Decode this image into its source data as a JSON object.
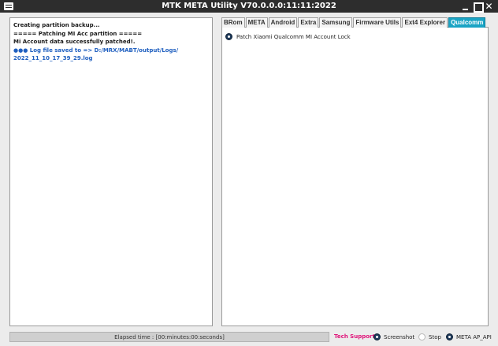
{
  "window": {
    "title": "MTK META Utility V70.0.0.0:11:11:2022",
    "minimize_glyph": "",
    "maximize_glyph": "",
    "close_glyph": "✕"
  },
  "log": {
    "lines": [
      {
        "text": "Creating partition backup..."
      },
      {
        "text": "===== Patching MI Acc partition ====="
      },
      {
        "text": "Mi Account data successfully patched!."
      },
      {
        "text": "●●● Log file saved to => D:/MRX/MABT/output/Logs/"
      },
      {
        "text": "2022_11_10_17_39_29.log"
      }
    ]
  },
  "tabs": [
    {
      "label": "BRom"
    },
    {
      "label": "META"
    },
    {
      "label": "Android"
    },
    {
      "label": "Extra"
    },
    {
      "label": "Samsung"
    },
    {
      "label": "Firmware Utils"
    },
    {
      "label": "Ext4 Explorer"
    },
    {
      "label": "Qualcomm"
    }
  ],
  "active_tab": "Qualcomm",
  "qualcomm": {
    "option_label": "Patch Xiaomi Qualcomm MI Account Lock",
    "option_selected": true
  },
  "status": {
    "elapsed": "Elapsed time : [00:minutes:00:seconds]",
    "tech_support": "Tech Support",
    "options": [
      {
        "label": "Screenshot",
        "selected": true
      },
      {
        "label": "Stop",
        "selected": false
      },
      {
        "label": "META AP_API",
        "selected": true
      }
    ]
  },
  "colors": {
    "title_bar": "#2d2d2d",
    "active_tab": "#1aa4c4",
    "log_highlight": "#1f5fbf",
    "tech_support": "#e0157a"
  }
}
